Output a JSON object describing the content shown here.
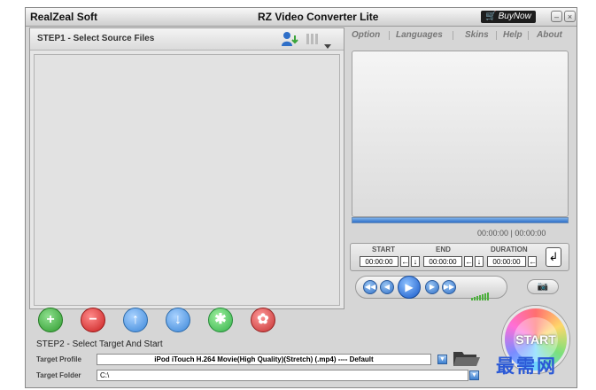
{
  "titlebar": {
    "brand": "RealZeal Soft",
    "title": "RZ Video Converter Lite",
    "buy_label": "BuyNow",
    "minimize_symbol": "–",
    "close_symbol": "×"
  },
  "step1": {
    "title": "STEP1 - Select Source Files",
    "icons": [
      "user-download-icon",
      "columns-icon",
      "dropdown-arrow-icon"
    ]
  },
  "menu": {
    "items": [
      "Option",
      "Languages",
      "Skins",
      "Help",
      "About"
    ]
  },
  "player": {
    "timecode": "00:00:00 | 00:00:00",
    "trim": {
      "start_label": "START",
      "end_label": "END",
      "duration_label": "DURATION",
      "start_value": "00:00:00",
      "end_value": "00:00:00",
      "duration_value": "00:00:00"
    },
    "enter_symbol": "↲",
    "play_symbol": "▶",
    "prev_symbol": "◀◀",
    "rew_symbol": "◀",
    "fwd_symbol": "▶",
    "next_symbol": "▶▶",
    "snapshot_symbol": "📷"
  },
  "actions": {
    "add": "+",
    "remove": "−",
    "up": "↑",
    "down": "↓",
    "settings": "✱",
    "effects": "✿"
  },
  "step2": {
    "title": "STEP2 - Select Target And Start",
    "profile_label": "Target Profile",
    "profile_value": "iPod iTouch H.264 Movie(High Quality)(Stretch) (.mp4) ---- Default",
    "folder_label": "Target Folder",
    "folder_value": "C:\\"
  },
  "start": {
    "label": "START"
  },
  "watermark": "最需网",
  "colors": {
    "accent_blue": "#2f6fc8",
    "add_green": "#3aa43a",
    "remove_red": "#d62b2b",
    "watermark_blue": "#2b59d6"
  }
}
